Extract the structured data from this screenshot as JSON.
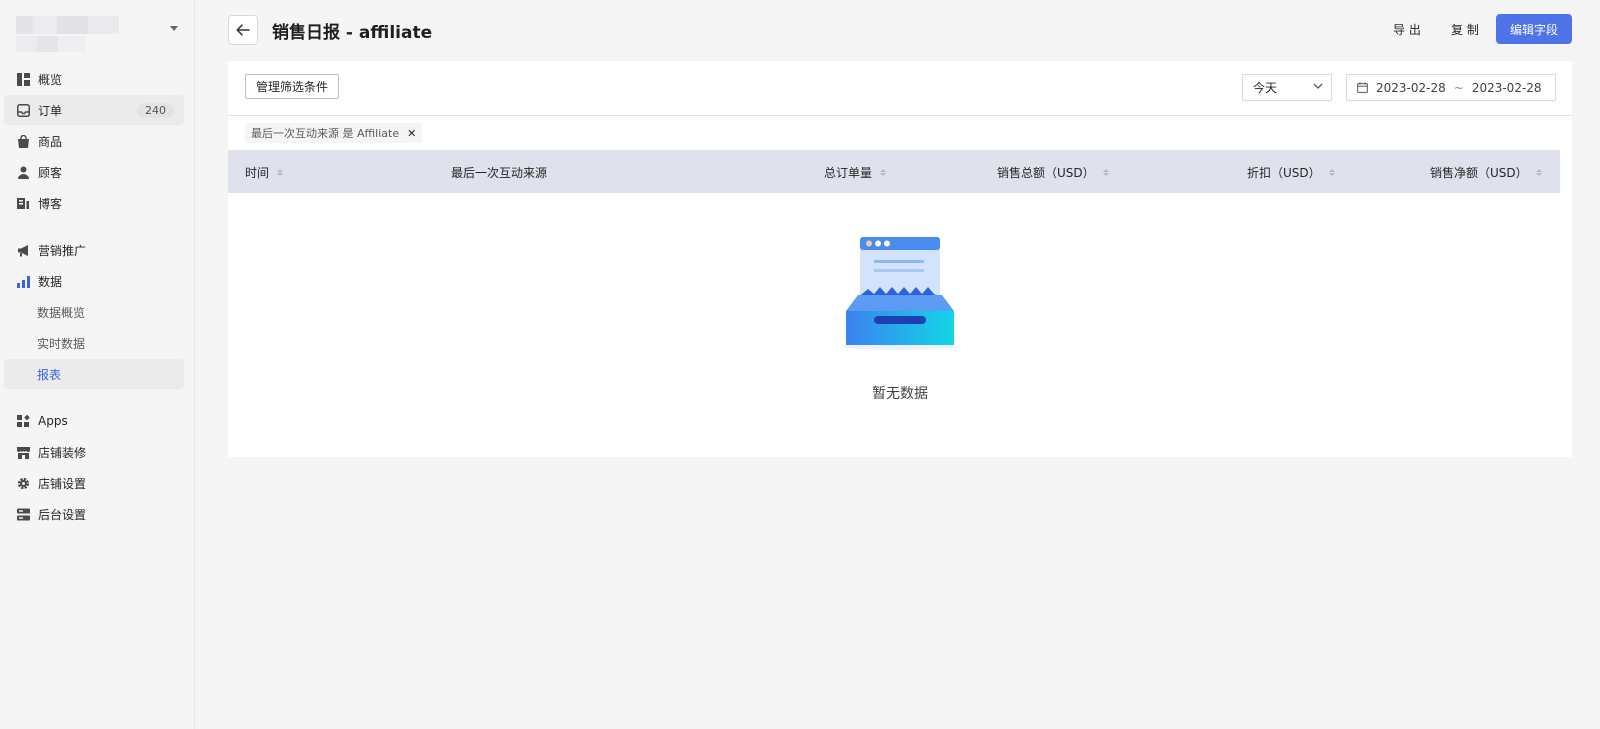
{
  "sidebar": {
    "items": [
      {
        "label": "概览",
        "icon": "dashboard-icon"
      },
      {
        "label": "订单",
        "icon": "inbox-icon",
        "badge": "240"
      },
      {
        "label": "商品",
        "icon": "bag-icon"
      },
      {
        "label": "顾客",
        "icon": "user-icon"
      },
      {
        "label": "博客",
        "icon": "blog-icon"
      },
      {
        "label": "营销推广",
        "icon": "megaphone-icon"
      },
      {
        "label": "数据",
        "icon": "bar-chart-icon"
      },
      {
        "label": "Apps",
        "icon": "apps-icon"
      },
      {
        "label": "店铺装修",
        "icon": "store-icon"
      },
      {
        "label": "店铺设置",
        "icon": "gear-icon"
      },
      {
        "label": "后台设置",
        "icon": "server-icon"
      }
    ],
    "sub_items": [
      {
        "label": "数据概览"
      },
      {
        "label": "实时数据"
      },
      {
        "label": "报表"
      }
    ]
  },
  "header": {
    "title": "销售日报 - affiliate",
    "export_label": "导 出",
    "copy_label": "复 制",
    "edit_fields_label": "编辑字段"
  },
  "toolbar": {
    "manage_filters_label": "管理筛选条件",
    "period_select_value": "今天",
    "date_start": "2023-02-28",
    "date_sep": "~",
    "date_end": "2023-02-28"
  },
  "filter_tag": {
    "text": "最后一次互动来源 是 Affiliate",
    "close": "✕"
  },
  "table": {
    "columns": [
      {
        "label": "时间",
        "sortable": true
      },
      {
        "label": "最后一次互动来源",
        "sortable": false
      },
      {
        "label": "总订单量",
        "sortable": true
      },
      {
        "label": "销售总额（USD）",
        "sortable": true
      },
      {
        "label": "折扣（USD）",
        "sortable": true
      },
      {
        "label": "销售净额（USD）",
        "sortable": true
      }
    ],
    "rows": []
  },
  "empty_state": {
    "text": "暂无数据"
  },
  "colors": {
    "primary": "#4e72e8",
    "active_link": "#3a64d8",
    "table_header_bg": "#dfe2ec"
  }
}
